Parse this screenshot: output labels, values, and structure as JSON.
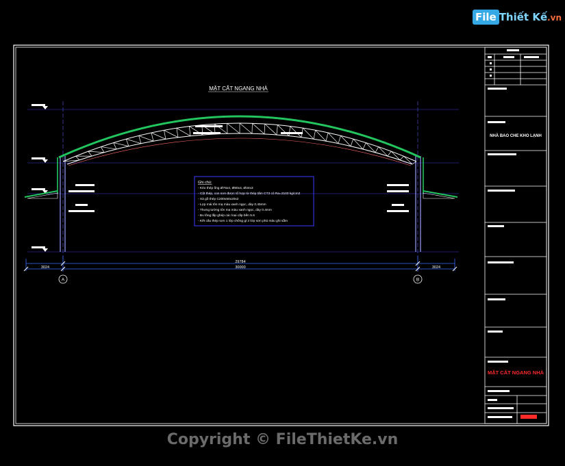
{
  "watermark": {
    "logo_main": "File",
    "logo_rest": "Thiết Kế",
    "logo_tld": ".vn",
    "copyright": "Copyright © FileThietKe.vn"
  },
  "drawing": {
    "title": "MẶT CẮT NGANG NHÀ",
    "dimensions": {
      "left_offset": "3024",
      "inner_span": "29784",
      "total_span": "30000",
      "right_offset": "3024"
    },
    "axes": [
      "A",
      "B"
    ],
    "notes": {
      "heading": "Ghi chú:",
      "lines": [
        "- Kèo thép ống Ø76x4, Ø60x4, Ø34x3",
        "- Cột thép, con sơn được tổ hợp từ thép tấm CT3 có Ra=2100 kg/cm2",
        "- Xà gồ thép C200x50x20x2",
        "- Lợp mái tôn mạ màu xanh ngọc, dày 0.45mm",
        "- Thưng tường tôn mạ màu xanh ngọc, dày 0.4mm",
        "- Bu lông lắp ghép các loại cấp bền 5.6",
        "- Kết cấu thép sơn 1 lớp chống gỉ 2 lớp sơn phủ màu ghi sẫm"
      ]
    }
  },
  "title_block": {
    "project": "NHÀ BAO CHE KHO LẠNH",
    "sheet_title": "MẶT CẮT NGANG NHÀ"
  },
  "colors": {
    "background": "#000000",
    "frame": "#ffffff",
    "roof": "#22c55e",
    "truss": "#ffffff",
    "grid": "#3a3ad8",
    "dimension": "#3b6bff",
    "sheet_title": "#ff2a2a",
    "column": "#9aa0ff"
  }
}
